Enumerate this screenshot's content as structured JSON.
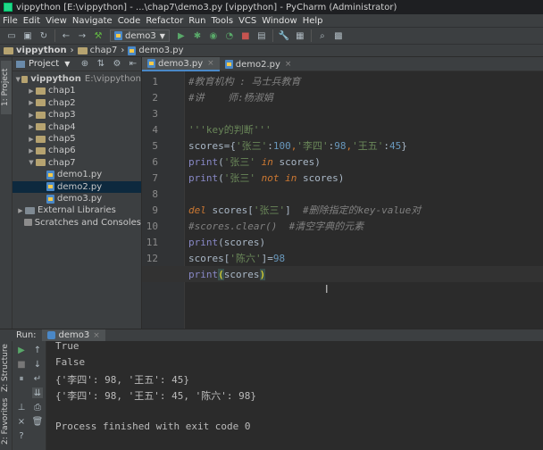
{
  "window": {
    "title": "vippython [E:\\vippython] - ...\\chap7\\demo3.py [vippython] - PyCharm (Administrator)"
  },
  "menu": [
    "File",
    "Edit",
    "View",
    "Navigate",
    "Code",
    "Refactor",
    "Run",
    "Tools",
    "VCS",
    "Window",
    "Help"
  ],
  "toolbar": {
    "run_config": "demo3"
  },
  "breadcrumb": [
    "vippython",
    "chap7",
    "demo3.py"
  ],
  "left_strip": {
    "project_tab": "1: Project",
    "structure_tab": "Z: Structure",
    "favorites_tab": "2: Favorites"
  },
  "project_panel": {
    "title": "Project",
    "items": [
      {
        "label": "vippython",
        "suffix": "E:\\vippython",
        "kind": "folder",
        "level": 0,
        "open": true
      },
      {
        "label": "chap1",
        "kind": "folder",
        "level": 1,
        "open": false
      },
      {
        "label": "chap2",
        "kind": "folder",
        "level": 1,
        "open": false
      },
      {
        "label": "chap3",
        "kind": "folder",
        "level": 1,
        "open": false
      },
      {
        "label": "chap4",
        "kind": "folder",
        "level": 1,
        "open": false
      },
      {
        "label": "chap5",
        "kind": "folder",
        "level": 1,
        "open": false
      },
      {
        "label": "chap6",
        "kind": "folder",
        "level": 1,
        "open": false
      },
      {
        "label": "chap7",
        "kind": "folder",
        "level": 1,
        "open": true
      },
      {
        "label": "demo1.py",
        "kind": "py",
        "level": 2
      },
      {
        "label": "demo2.py",
        "kind": "py",
        "level": 2,
        "selected": true
      },
      {
        "label": "demo3.py",
        "kind": "py",
        "level": 2
      },
      {
        "label": "External Libraries",
        "kind": "lib",
        "level": 0,
        "open": false
      },
      {
        "label": "Scratches and Consoles",
        "kind": "scratch",
        "level": 0
      }
    ]
  },
  "editor": {
    "tabs": [
      {
        "label": "demo3.py",
        "active": true
      },
      {
        "label": "demo2.py",
        "active": false
      }
    ],
    "current_line": 13,
    "lines": [
      {
        "n": "1",
        "tokens": [
          {
            "t": "#教育机构 : 马士兵教育",
            "c": "com"
          }
        ]
      },
      {
        "n": "2",
        "tokens": [
          {
            "t": "#讲    师:杨淑娟",
            "c": "com"
          }
        ]
      },
      {
        "n": "3",
        "tokens": []
      },
      {
        "n": "4",
        "tokens": [
          {
            "t": "'''key的判断'''",
            "c": "str"
          }
        ]
      },
      {
        "n": "5",
        "tokens": [
          {
            "t": "scores",
            "c": "txt"
          },
          {
            "t": "=",
            "c": "txt"
          },
          {
            "t": "{",
            "c": "txt"
          },
          {
            "t": "'张三'",
            "c": "str"
          },
          {
            "t": ":",
            "c": "txt"
          },
          {
            "t": "100",
            "c": "num"
          },
          {
            "t": ",",
            "c": "op"
          },
          {
            "t": "'李四'",
            "c": "str"
          },
          {
            "t": ":",
            "c": "txt"
          },
          {
            "t": "98",
            "c": "num"
          },
          {
            "t": ",",
            "c": "op"
          },
          {
            "t": "'王五'",
            "c": "str"
          },
          {
            "t": ":",
            "c": "txt"
          },
          {
            "t": "45",
            "c": "num"
          },
          {
            "t": "}",
            "c": "txt"
          }
        ]
      },
      {
        "n": "6",
        "tokens": [
          {
            "t": "print",
            "c": "fn"
          },
          {
            "t": "(",
            "c": "txt"
          },
          {
            "t": "'张三'",
            "c": "str"
          },
          {
            "t": " in ",
            "c": "kw"
          },
          {
            "t": "scores)",
            "c": "txt"
          }
        ]
      },
      {
        "n": "7",
        "tokens": [
          {
            "t": "print",
            "c": "fn"
          },
          {
            "t": "(",
            "c": "txt"
          },
          {
            "t": "'张三'",
            "c": "str"
          },
          {
            "t": " not in ",
            "c": "kw"
          },
          {
            "t": "scores)",
            "c": "txt"
          }
        ]
      },
      {
        "n": "8",
        "tokens": []
      },
      {
        "n": "9",
        "tokens": [
          {
            "t": "del",
            "c": "kw"
          },
          {
            "t": " scores[",
            "c": "txt"
          },
          {
            "t": "'张三'",
            "c": "str"
          },
          {
            "t": "]  ",
            "c": "txt"
          },
          {
            "t": "#删除指定的key-value对",
            "c": "com"
          }
        ]
      },
      {
        "n": "10",
        "tokens": [
          {
            "t": "#scores.clear()  #清空字典的元素",
            "c": "com"
          }
        ]
      },
      {
        "n": "11",
        "tokens": [
          {
            "t": "print",
            "c": "fn"
          },
          {
            "t": "(scores)",
            "c": "txt"
          }
        ]
      },
      {
        "n": "12",
        "tokens": [
          {
            "t": "scores[",
            "c": "txt"
          },
          {
            "t": "'陈六'",
            "c": "str"
          },
          {
            "t": "]=",
            "c": "txt"
          },
          {
            "t": "98",
            "c": "num"
          }
        ]
      },
      {
        "n": "13",
        "tokens": [
          {
            "t": "print",
            "c": "fn"
          },
          {
            "t": "(",
            "c": "bracket"
          },
          {
            "t": "scores",
            "c": "txt"
          },
          {
            "t": ")",
            "c": "bracket"
          }
        ]
      }
    ]
  },
  "run_panel": {
    "label": "Run:",
    "tab": "demo3",
    "output": [
      "True",
      "False",
      "{'李四': 98, '王五': 45}",
      "{'李四': 98, '王五': 45, '陈六': 98}",
      "",
      "Process finished with exit code 0"
    ]
  }
}
